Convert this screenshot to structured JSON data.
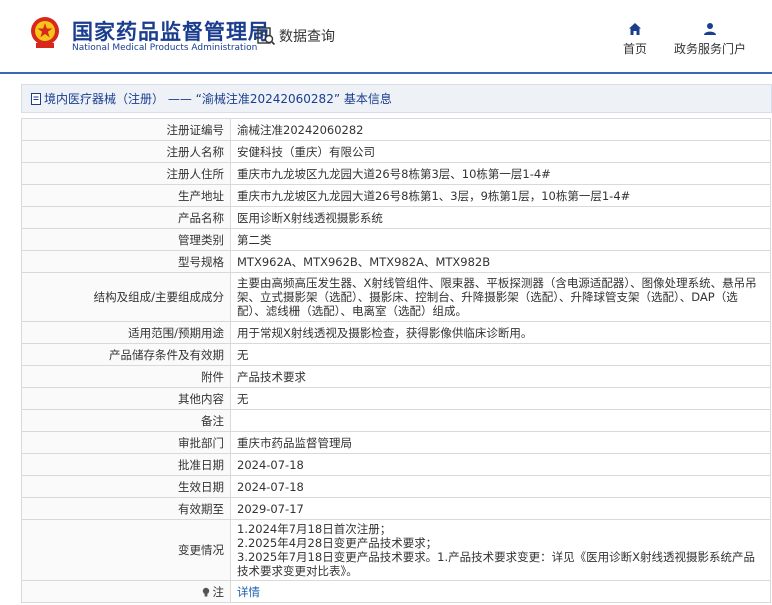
{
  "header": {
    "title": "国家药品监督管理局",
    "subtitle": "National Medical Products Administration",
    "query_label": "数据查询",
    "nav_home": "首页",
    "nav_gov": "政务服务门户"
  },
  "panel": {
    "heading": "境内医疗器械（注册） —— “渝械注准20242060282” 基本信息"
  },
  "rows": [
    {
      "label": "注册证编号",
      "value": "渝械注准20242060282"
    },
    {
      "label": "注册人名称",
      "value": "安健科技（重庆）有限公司"
    },
    {
      "label": "注册人住所",
      "value": "重庆市九龙坡区九龙园大道26号8栋第3层、10栋第一层1-4#"
    },
    {
      "label": "生产地址",
      "value": "重庆市九龙坡区九龙园大道26号8栋第1、3层，9栋第1层，10栋第一层1-4#"
    },
    {
      "label": "产品名称",
      "value": "医用诊断X射线透视摄影系统"
    },
    {
      "label": "管理类别",
      "value": "第二类"
    },
    {
      "label": "型号规格",
      "value": "MTX962A、MTX962B、MTX982A、MTX982B"
    },
    {
      "label": "结构及组成/主要组成成分",
      "value": "主要由高频高压发生器、X射线管组件、限束器、平板探测器（含电源适配器）、图像处理系统、悬吊吊架、立式摄影架（选配）、摄影床、控制台、升降摄影架（选配）、升降球管支架（选配）、DAP（选配）、滤线栅（选配）、电离室（选配）组成。"
    },
    {
      "label": "适用范围/预期用途",
      "value": "用于常规X射线透视及摄影检查，获得影像供临床诊断用。"
    },
    {
      "label": "产品储存条件及有效期",
      "value": "无"
    },
    {
      "label": "附件",
      "value": "产品技术要求"
    },
    {
      "label": "其他内容",
      "value": "无"
    },
    {
      "label": "备注",
      "value": ""
    },
    {
      "label": "审批部门",
      "value": "重庆市药品监督管理局"
    },
    {
      "label": "批准日期",
      "value": "2024-07-18"
    },
    {
      "label": "生效日期",
      "value": "2024-07-18"
    },
    {
      "label": "有效期至",
      "value": "2029-07-17"
    }
  ],
  "changes": {
    "label": "变更情况",
    "lines": [
      "1.2024年7月18日首次注册；",
      "2.2025年4月28日变更产品技术要求；",
      "3.2025年7月18日变更产品技术要求。1.产品技术要求变更：详见《医用诊断X射线透视摄影系统产品技术要求变更对比表》。"
    ]
  },
  "footer_row": {
    "label": "注",
    "link": "详情"
  },
  "colors": {
    "brand_blue": "#1a3d8f",
    "header_line": "#3a66b8",
    "link": "#1a5fb4"
  }
}
